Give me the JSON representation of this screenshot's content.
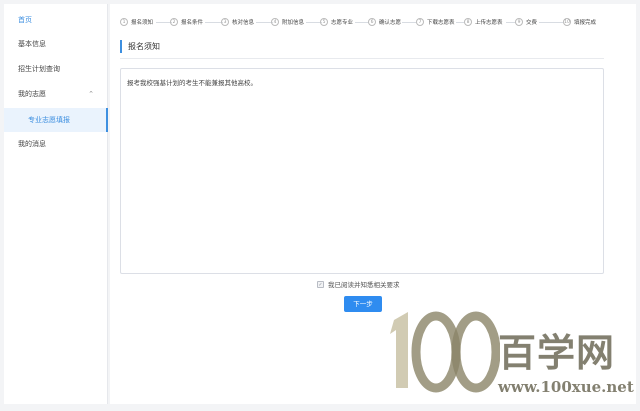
{
  "sidebar": {
    "items": [
      {
        "label": "首页"
      },
      {
        "label": "基本信息"
      },
      {
        "label": "招生计划查询"
      },
      {
        "label": "我的志愿"
      },
      {
        "label": "专业志愿填报"
      },
      {
        "label": "我的消息"
      }
    ],
    "expand_icon": "chevron-up-icon"
  },
  "steps": [
    {
      "num": "1",
      "label": "报名须知"
    },
    {
      "num": "2",
      "label": "报名条件"
    },
    {
      "num": "3",
      "label": "核对信息"
    },
    {
      "num": "4",
      "label": "附加信息"
    },
    {
      "num": "5",
      "label": "志愿专业"
    },
    {
      "num": "6",
      "label": "确认志愿"
    },
    {
      "num": "7",
      "label": "下载志愿表"
    },
    {
      "num": "8",
      "label": "上传志愿表"
    },
    {
      "num": "9",
      "label": "交费"
    },
    {
      "num": "10",
      "label": "填报完成"
    }
  ],
  "section": {
    "title": "报名须知"
  },
  "notice": {
    "text": "报考我校强基计划的考生不能兼报其他高校。"
  },
  "agreement": {
    "label": "我已阅读并知悉相关要求",
    "checked": true
  },
  "next_button": {
    "label": "下一步"
  },
  "watermark": {
    "logo_text": "100",
    "name": "百学网",
    "url": "www.100xue.net"
  },
  "colors": {
    "accent": "#3d8fe0",
    "button": "#2f8cf0",
    "watermark": "#6e6a58"
  }
}
